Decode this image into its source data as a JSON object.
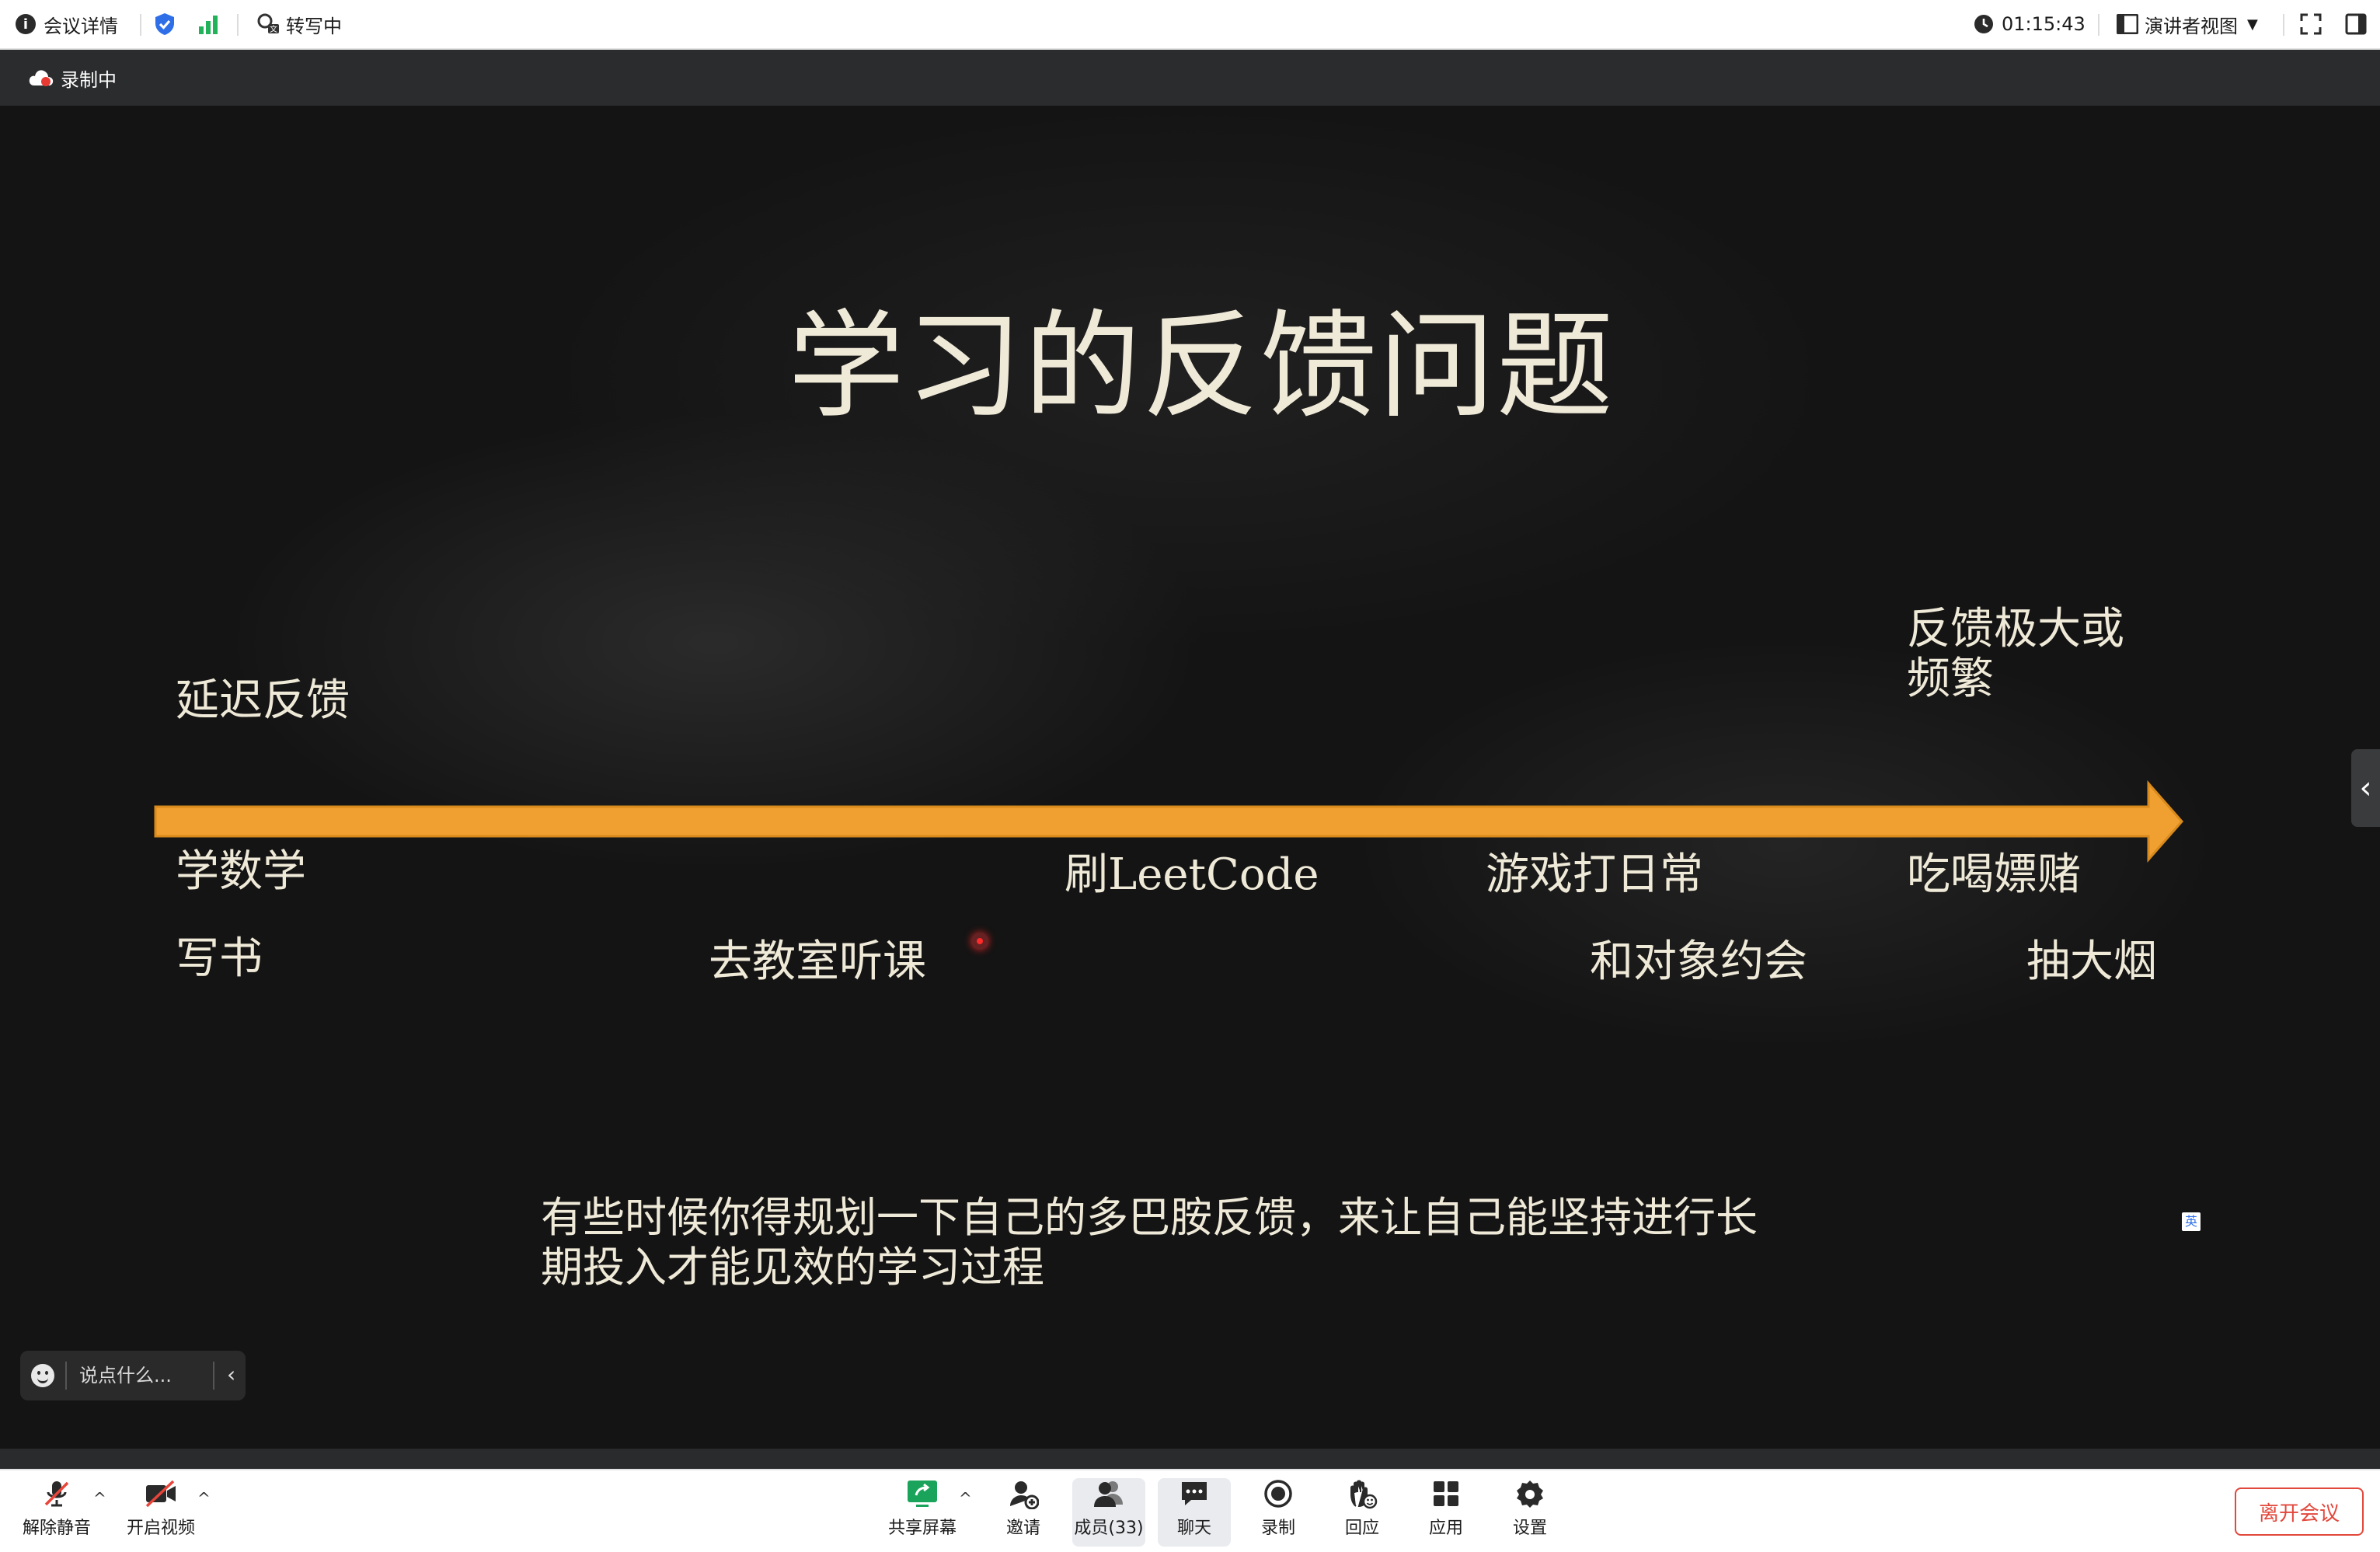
{
  "topbar": {
    "meeting_info": "会议详情",
    "transcribing": "转写中",
    "timer": "01:15:43",
    "view_mode": "演讲者视图"
  },
  "recording": {
    "label": "录制中"
  },
  "slide": {
    "title": "学习的反馈问题",
    "left_label": "延迟反馈",
    "right_label_line1": "反馈极大或",
    "right_label_line2": "频繁",
    "items": [
      "学数学",
      "写书",
      "去教室听课",
      "刷LeetCode",
      "游戏打日常",
      "和对象约会",
      "吃喝嫖赌",
      "抽大烟"
    ],
    "caption_line1": "有些时候你得规划一下自己的多巴胺反馈，来让自己能坚持进行长",
    "caption_line2": "期投入才能见效的学习过程",
    "lang_badge": "英",
    "arrow_color": "#f0a030",
    "text_color": "#efe9d8"
  },
  "chat": {
    "placeholder": "说点什么..."
  },
  "toolbar": {
    "unmute": "解除静音",
    "start_video": "开启视频",
    "share_screen": "共享屏幕",
    "invite": "邀请",
    "members": "成员(33)",
    "chat": "聊天",
    "record": "录制",
    "react": "回应",
    "apps": "应用",
    "settings": "设置",
    "leave": "离开会议",
    "leave_color": "#e2483c",
    "share_color": "#1aa35a"
  }
}
